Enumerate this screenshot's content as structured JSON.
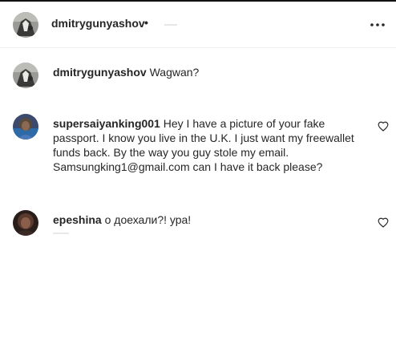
{
  "header": {
    "username": "dmitrygunyashov",
    "separator": "•"
  },
  "comments": [
    {
      "username": "dmitrygunyashov",
      "text": "Wagwan?"
    },
    {
      "username": "supersaiyanking001",
      "text": "Hey I have a picture of your fake passport. I know you live in the U.K. I just want my freewallet funds back. By the way you guy stole my email. Samsungking1@gmail.com can I have it back please?"
    },
    {
      "username": "epeshina",
      "text": "о доехали?! ура!"
    }
  ],
  "icons": {
    "more": "more-horizontal-icon",
    "like": "heart-outline-icon"
  }
}
